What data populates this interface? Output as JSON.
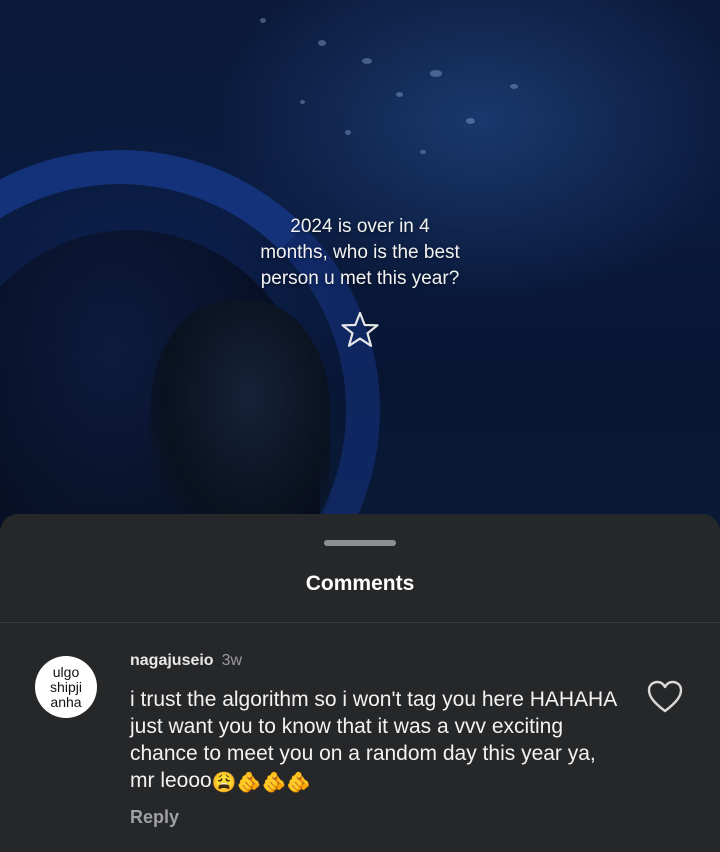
{
  "video": {
    "overlay_lines": [
      "2024 is over in 4",
      "months, who is the best",
      "person u met this year?"
    ],
    "icon": "star-outline-icon"
  },
  "comments_sheet": {
    "title": "Comments",
    "comments": [
      {
        "avatar_lines": [
          "ulgo",
          "shipji",
          "anha"
        ],
        "username": "nagajuseio",
        "time": "3w",
        "text": "i trust the algorithm so i won't tag you here HAHAHA just want you to know that it was a vvv exciting chance to meet you on a random day this year ya, mr leooo",
        "emojis": "😩🫵🫵🫵",
        "reply_label": "Reply",
        "like_icon": "heart-outline-icon"
      }
    ]
  }
}
